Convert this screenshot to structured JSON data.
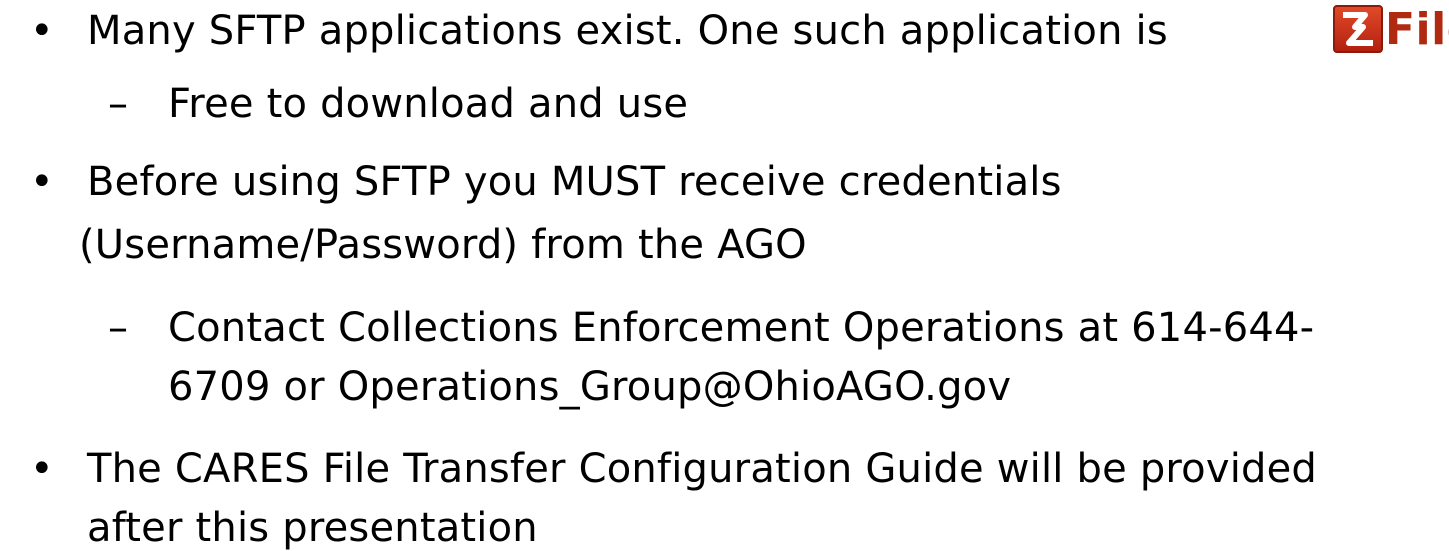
{
  "bullets": {
    "b1": "Many SFTP applications exist. One such application is",
    "b1_sub1": "Free to download and use",
    "b2_line1": "Before using SFTP you MUST receive credentials",
    "b2_line2": "(Username/Password) from the AGO",
    "b2_sub1_line1": "Contact Collections Enforcement Operations at 614-644-",
    "b2_sub1_line2": "6709 or Operations_Group@OhioAGO.gov",
    "b3_line1": "The CARES File Transfer Configuration Guide will be provided",
    "b3_line2": "after this presentation"
  },
  "symbols": {
    "bullet": "•",
    "dash": "–"
  },
  "logo": {
    "text": "FileZ",
    "icon": "filezilla-logo-icon",
    "color": "#b02a12"
  }
}
